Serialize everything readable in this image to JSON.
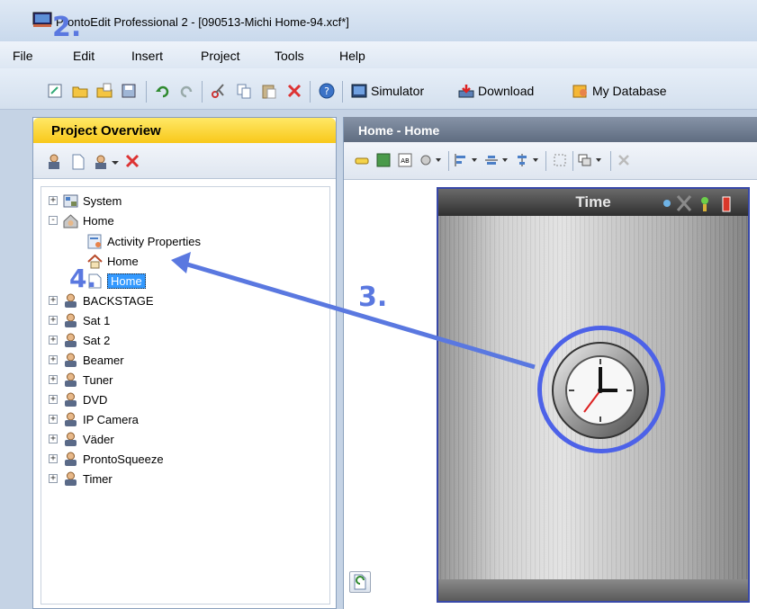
{
  "window": {
    "title": "ProntoEdit Professional 2 - [090513-Michi Home-94.xcf*]"
  },
  "annotations": {
    "step2": "2.",
    "step3": "3.",
    "step4": "4."
  },
  "menu": {
    "items": [
      "File",
      "Edit",
      "Insert",
      "Project",
      "Tools",
      "Help"
    ]
  },
  "toolbar": {
    "simulator_label": "Simulator",
    "download_label": "Download",
    "my_database_label": "My Database"
  },
  "project_overview": {
    "header": "Project Overview",
    "tree": [
      {
        "label": "System",
        "expander": "+",
        "icon": "system-icon"
      },
      {
        "label": "Home",
        "expander": "-",
        "icon": "home-activity-icon"
      },
      {
        "label": "Activity Properties",
        "icon": "properties-icon"
      },
      {
        "label": "Home",
        "icon": "home-icon"
      },
      {
        "label": "Home",
        "icon": "page-icon",
        "selected": true
      },
      {
        "label": "BACKSTAGE",
        "expander": "+",
        "icon": "user-icon"
      },
      {
        "label": "Sat 1",
        "expander": "+",
        "icon": "user-icon"
      },
      {
        "label": "Sat 2",
        "expander": "+",
        "icon": "user-icon"
      },
      {
        "label": "Beamer",
        "expander": "+",
        "icon": "user-icon"
      },
      {
        "label": "Tuner",
        "expander": "+",
        "icon": "user-icon"
      },
      {
        "label": "DVD",
        "expander": "+",
        "icon": "user-icon"
      },
      {
        "label": "IP Camera",
        "expander": "+",
        "icon": "user-icon"
      },
      {
        "label": "Väder",
        "expander": "+",
        "icon": "user-icon"
      },
      {
        "label": "ProntoSqueeze",
        "expander": "+",
        "icon": "user-icon"
      },
      {
        "label": "Timer",
        "expander": "+",
        "icon": "user-icon"
      }
    ]
  },
  "home_editor": {
    "header": "Home - Home",
    "device_title": "Time"
  },
  "colors": {
    "annotation": "#5a78e0",
    "po_header": "#f8c81a",
    "selection": "#3399ff"
  }
}
